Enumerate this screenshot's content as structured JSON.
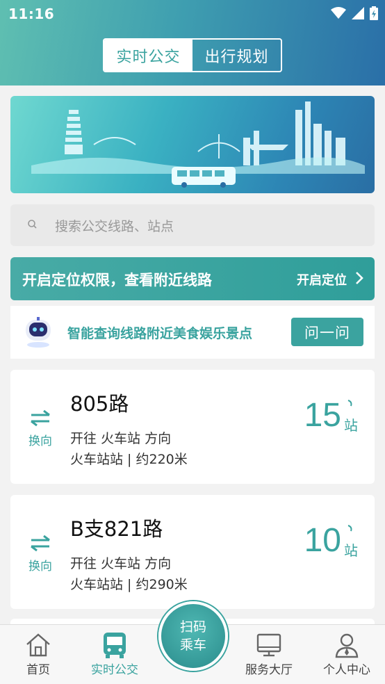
{
  "status_bar": {
    "time": "11:16"
  },
  "header": {
    "segments": [
      {
        "label": "实时公交",
        "active": true
      },
      {
        "label": "出行规划",
        "active": false
      }
    ]
  },
  "search": {
    "placeholder": "搜索公交线路、站点"
  },
  "location_prompt": {
    "message": "开启定位权限，查看附近线路",
    "action": "开启定位"
  },
  "ai_assistant": {
    "text": "智能查询线路附近美食娱乐景点",
    "button": "问一问"
  },
  "routes": [
    {
      "name": "805路",
      "swap_label": "换向",
      "direction": "开往 火车站 方向",
      "stop": "火车站站 | 约220米",
      "stops_away": "15",
      "unit": "站"
    },
    {
      "name": "B支821路",
      "swap_label": "换向",
      "direction": "开往 火车站 方向",
      "stop": "火车站站 | 约290米",
      "stops_away": "10",
      "unit": "站"
    }
  ],
  "tabbar": {
    "items": [
      {
        "label": "首页",
        "icon": "home-icon"
      },
      {
        "label": "实时公交",
        "icon": "bus-icon",
        "active": true
      },
      {
        "label": "服务大厅",
        "icon": "monitor-icon"
      },
      {
        "label": "个人中心",
        "icon": "user-icon"
      }
    ],
    "scan_line1": "扫码",
    "scan_line2": "乘车"
  },
  "colors": {
    "accent": "#3aa39f",
    "header_start": "#5fbfb1",
    "header_end": "#2a6fa8"
  }
}
